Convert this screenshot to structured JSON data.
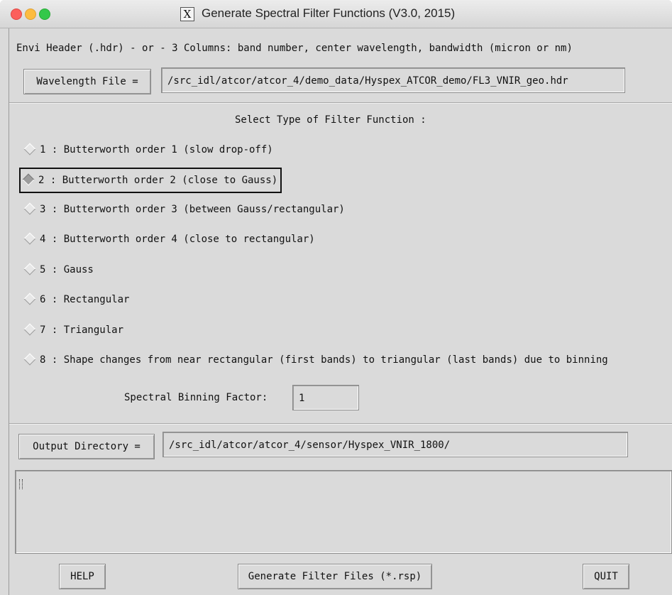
{
  "window": {
    "title": "Generate Spectral Filter Functions (V3.0, 2015)",
    "app_icon": "x11-icon"
  },
  "header": {
    "description": "Envi Header (.hdr) - or - 3 Columns: band number, center wavelength, bandwidth (micron or nm)"
  },
  "wavelength": {
    "button_label": "Wavelength File =",
    "path": "/src_idl/atcor/atcor_4/demo_data/Hyspex_ATCOR_demo/FL3_VNIR_geo.hdr"
  },
  "filter": {
    "heading": "Select Type of Filter Function :",
    "selected_index": 1,
    "options": [
      "1 : Butterworth order 1 (slow drop-off)",
      "2 : Butterworth order 2 (close to Gauss)",
      "3 : Butterworth order 3 (between Gauss/rectangular)",
      "4 : Butterworth order 4 (close to rectangular)",
      "5 : Gauss",
      "6 : Rectangular",
      "7 : Triangular",
      "8 : Shape changes from near rectangular (first bands) to triangular (last bands) due to binning"
    ]
  },
  "binning": {
    "label": "Spectral Binning Factor:",
    "value": "1"
  },
  "output": {
    "button_label": "Output Directory =",
    "path": "/src_idl/atcor/atcor_4/sensor/Hyspex_VNIR_1800/"
  },
  "log": {
    "text": ""
  },
  "footer": {
    "help_label": "HELP",
    "generate_label": "Generate Filter Files (*.rsp)",
    "quit_label": "QUIT"
  }
}
